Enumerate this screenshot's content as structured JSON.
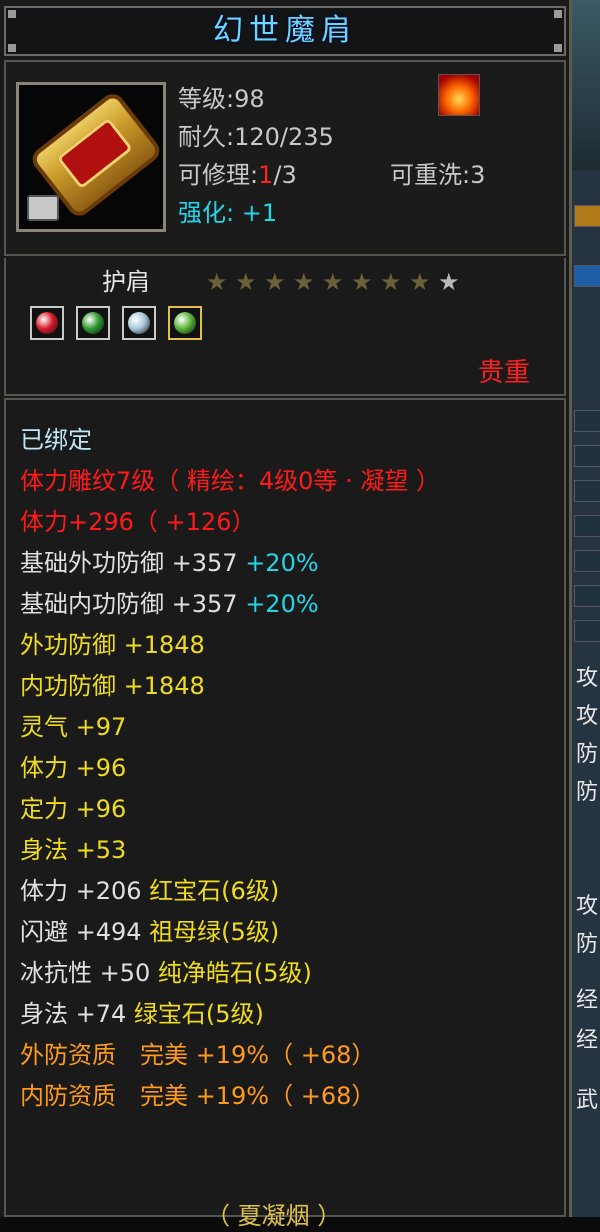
{
  "title": "幻世魔肩",
  "item": {
    "icon": "golden-scroll-shoulder-icon",
    "level_label": "等级",
    "level": "98",
    "durability_label": "耐久",
    "durability": "120/235",
    "repair_label": "可修理",
    "repair_used": "1",
    "repair_total": "/3",
    "rewash_label": "可重洗",
    "rewash": "3",
    "enhance_label": "强化:",
    "enhance": "+1",
    "type": "护肩",
    "stars_filled": 8,
    "stars_total": 9,
    "quality": "贵重"
  },
  "gems": [
    {
      "icon": "ruby-gem-icon",
      "color": "#d81a2a"
    },
    {
      "icon": "emerald-gem-icon",
      "color": "#2f9a2f"
    },
    {
      "icon": "pure-diamond-gem-icon",
      "color": "#a9c9d9"
    },
    {
      "icon": "green-gem-icon",
      "color": "#5ab53a"
    }
  ],
  "attributes": [
    {
      "text": "已绑定",
      "cls": "lb"
    },
    {
      "text": "体力雕纹7级（ 精绘：4级0等 · 凝望 ）",
      "cls": "rd"
    },
    {
      "text": "体力+296（ +126）",
      "cls": "rd"
    },
    {
      "text": "基础外功防御 +357 ",
      "extra": "+20%",
      "cls": "wh",
      "ecls": "cy"
    },
    {
      "text": "基础内功防御 +357 ",
      "extra": "+20%",
      "cls": "wh",
      "ecls": "cy"
    },
    {
      "text": "外功防御 +1848",
      "cls": "yl"
    },
    {
      "text": "内功防御 +1848",
      "cls": "yl"
    },
    {
      "text": "灵气 +97",
      "cls": "yl"
    },
    {
      "text": "体力 +96",
      "cls": "yl"
    },
    {
      "text": "定力 +96",
      "cls": "yl"
    },
    {
      "text": "身法 +53",
      "cls": "yl"
    },
    {
      "text": "体力 +206 ",
      "extra": "红宝石(6级)",
      "cls": "wh",
      "ecls": "yl"
    },
    {
      "text": "闪避 +494 ",
      "extra": "祖母绿(5级)",
      "cls": "wh",
      "ecls": "yl"
    },
    {
      "text": "冰抗性 +50 ",
      "extra": "纯净皓石(5级)",
      "cls": "wh",
      "ecls": "yl"
    },
    {
      "text": "身法 +74 ",
      "extra": "绿宝石(5级)",
      "cls": "wh",
      "ecls": "yl"
    },
    {
      "text": "外防资质　完美 +19%（ +68）",
      "cls": "or"
    },
    {
      "text": "内防资质　完美 +19%（ +68）",
      "cls": "or"
    }
  ],
  "footer": "（ 夏凝烟 ）",
  "side_panel": {
    "glyphs": [
      "攻",
      "攻",
      "防",
      "防",
      "攻",
      "防",
      "经",
      "经",
      "武"
    ]
  }
}
